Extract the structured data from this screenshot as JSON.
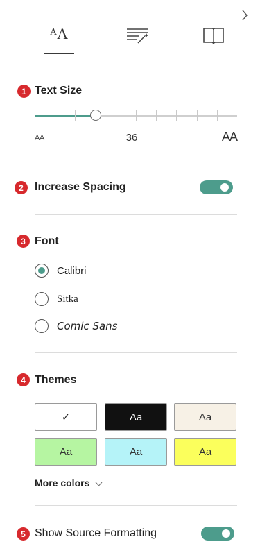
{
  "tabs": [
    {
      "name": "text-options",
      "icon": "text-size-icon",
      "active": true
    },
    {
      "name": "grammar-options",
      "icon": "grammar-options-icon",
      "active": false
    },
    {
      "name": "reading-preferences",
      "icon": "book-icon",
      "active": false
    }
  ],
  "badges": [
    "1",
    "2",
    "3",
    "4",
    "5"
  ],
  "text_size": {
    "label": "Text Size",
    "small_aa": "AA",
    "large_aa": "AA",
    "value": "36",
    "slider_fraction": 0.3
  },
  "spacing": {
    "label": "Increase Spacing",
    "on": true
  },
  "font": {
    "label": "Font",
    "options": [
      "Calibri",
      "Sitka",
      "Comic Sans"
    ],
    "selected": "Calibri"
  },
  "themes": {
    "label": "Themes",
    "swatches": [
      {
        "text": "✓",
        "bg": "#ffffff",
        "fg": "#222222"
      },
      {
        "text": "Aa",
        "bg": "#111111",
        "fg": "#ffffff"
      },
      {
        "text": "Aa",
        "bg": "#f7f1e6",
        "fg": "#333333"
      },
      {
        "text": "Aa",
        "bg": "#b6f5a2",
        "fg": "#333333"
      },
      {
        "text": "Aa",
        "bg": "#b5f3f8",
        "fg": "#333333"
      },
      {
        "text": "Aa",
        "bg": "#fbff5c",
        "fg": "#333333"
      }
    ],
    "more_colors": "More colors"
  },
  "source_formatting": {
    "label": "Show Source Formatting",
    "on": true
  },
  "colors": {
    "accent": "#4d9c8c",
    "badge": "#d7292d"
  }
}
